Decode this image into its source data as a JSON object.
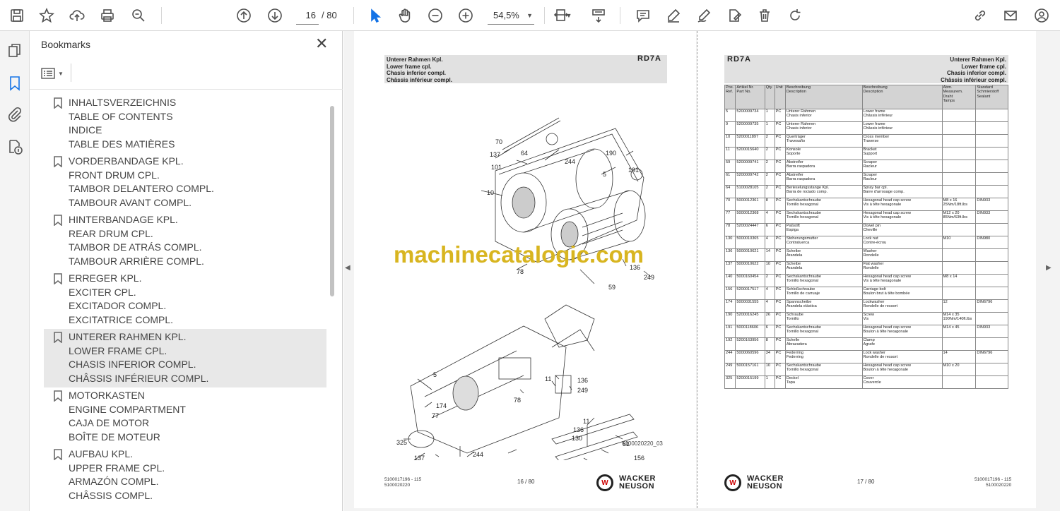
{
  "toolbar": {
    "page_current": "16",
    "page_total": "/ 80",
    "zoom": "54,5%"
  },
  "bookmarks_panel": {
    "title": "Bookmarks",
    "groups": [
      {
        "lines": [
          "INHALTSVERZEICHNIS",
          "TABLE OF CONTENTS",
          "INDICE",
          "TABLE DES MATIÈRES"
        ],
        "selected": false
      },
      {
        "lines": [
          "VORDERBANDAGE KPL.",
          "FRONT DRUM CPL.",
          "TAMBOR DELANTERO COMPL.",
          "TAMBOUR AVANT COMPL."
        ],
        "selected": false
      },
      {
        "lines": [
          "HINTERBANDAGE KPL.",
          "REAR DRUM CPL.",
          "TAMBOR DE ATRÁS COMPL.",
          "TAMBOUR ARRIÈRE COMPL."
        ],
        "selected": false
      },
      {
        "lines": [
          "ERREGER KPL.",
          "EXCITER CPL.",
          "EXCITADOR COMPL.",
          "EXCITATRICE COMPL."
        ],
        "selected": false
      },
      {
        "lines": [
          "UNTERER RAHMEN KPL.",
          "LOWER FRAME CPL.",
          "CHASIS INFERIOR COMPL.",
          "CHÂSSIS INFÉRIEUR COMPL."
        ],
        "selected": true
      },
      {
        "lines": [
          "MOTORKASTEN",
          "ENGINE COMPARTMENT",
          "CAJA DE MOTOR",
          "BOÎTE DE MOTEUR"
        ],
        "selected": false
      },
      {
        "lines": [
          "AUFBAU KPL.",
          "UPPER FRAME CPL.",
          "ARMAZÓN COMPL.",
          "CHÂSSIS COMPL."
        ],
        "selected": false
      }
    ]
  },
  "page_left": {
    "header_lines": [
      "Unterer Rahmen Kpl.",
      "Lower frame cpl.",
      "Chasis inferior compl.",
      "Châssis inférieur compl."
    ],
    "model": "RD7A",
    "watermark": "machinecatalogic.com",
    "drawing_id": "5100020220_03",
    "callouts": [
      "70",
      "137",
      "64",
      "101",
      "244",
      "190",
      "5",
      "191",
      "10",
      "78",
      "136",
      "249",
      "59",
      "5",
      "174",
      "77",
      "325",
      "140",
      "137",
      "191",
      "244",
      "244",
      "190",
      "11",
      "249",
      "136",
      "78",
      "136",
      "130",
      "11",
      "61",
      "156",
      "136",
      "130"
    ],
    "footer_doc": [
      "5100017196 - 115",
      "5100020220"
    ],
    "footer_page": "16 / 80",
    "brand_top": "WACKER",
    "brand_bottom": "NEUSON"
  },
  "page_right": {
    "model": "RD7A",
    "header_lines": [
      "Unterer Rahmen Kpl.",
      "Lower frame cpl.",
      "Chasis inferior compl.",
      "Châssis inférieur compl."
    ],
    "columns": [
      "Pos.\nRef.",
      "Artikel Nr.\nPart No.",
      "Qty.",
      "Unit",
      "Beschreibung\nDescription",
      "Beschreibung\nDescription",
      "Abm.\nMeasurem.\nDraht\nTamps",
      "Standard\nSchmierstoff\nSealant"
    ],
    "rows": [
      [
        "5",
        "5200009734",
        "1",
        "PC",
        "Unterer Rahmen\nChasis inferior",
        "Lower frame\nChâssis inférieur",
        "",
        ""
      ],
      [
        "9",
        "5200009735",
        "1",
        "PC",
        "Unterer Rahmen\nChasis inferior",
        "Lower frame\nChâssis inférieur",
        "",
        ""
      ],
      [
        "10",
        "5200011897",
        "2",
        "PC",
        "Querträger\nTravesaño",
        "Cross member\nTraverse",
        "",
        ""
      ],
      [
        "11",
        "5200015640",
        "2",
        "PC",
        "Konsole\nSoporte",
        "Bracket\nSupport",
        "",
        ""
      ],
      [
        "59",
        "5200009741",
        "2",
        "PC",
        "Abstreifer\nBarra raspadora",
        "Scraper\nRacleur",
        "",
        ""
      ],
      [
        "61",
        "5200009742",
        "2",
        "PC",
        "Abstreifer\nBarra raspadora",
        "Scraper\nRacleur",
        "",
        ""
      ],
      [
        "64",
        "5100028105",
        "2",
        "PC",
        "Berieselungsstange Kpl.\nBarra de rociado comp.",
        "Spray bar cpl.\nBarre d'arrosage comp.",
        "",
        ""
      ],
      [
        "70",
        "5000012361",
        "8",
        "PC",
        "Sechskantschraube\nTornillo hexagonal",
        "Hexagonal head cap screw\nVis à tête hexagonale",
        "M8 x 16\n25Nm/18ft.lbs",
        "DIN933"
      ],
      [
        "77",
        "5000012368",
        "4",
        "PC",
        "Sechskantschraube\nTornillo hexagonal",
        "Hexagonal head cap screw\nVis à tête hexagonale",
        "M12 x 20\n85Nm/63ft.lbs",
        "DIN933"
      ],
      [
        "78",
        "5200024447",
        "6",
        "PC",
        "Paßstift\nEspiga",
        "Dowel pin\nCheville",
        "",
        ""
      ],
      [
        "130",
        "5000010365",
        "4",
        "PC",
        "Stoherungsmutter\nContratuerca",
        "Lock nut\nContre-écrou",
        "M10",
        "DIN980"
      ],
      [
        "136",
        "5000010621",
        "14",
        "PC",
        "Scheibe\nArandela",
        "Washer\nRondelle",
        "",
        ""
      ],
      [
        "137",
        "5000010622",
        "10",
        "PC",
        "Scheibe\nArandela",
        "Flat washer\nRondelle",
        "",
        ""
      ],
      [
        "140",
        "5000160454",
        "2",
        "PC",
        "Sechskantschraube\nTornillo hexagonal",
        "Hexagonal head cap screw\nVis à tête hexagonale",
        "M8 x 14",
        ""
      ],
      [
        "156",
        "5200017517",
        "4",
        "PC",
        "Schloßschraube\nTornillo de carruaje",
        "Carriage bolt\nBoulon brut à tête bombée",
        "",
        ""
      ],
      [
        "174",
        "5000031555",
        "4",
        "PC",
        "Spannscheibe\nArandela elástica",
        "Lockwasher\nRondelle de ressort",
        "12",
        "DIN6796"
      ],
      [
        "190",
        "5200016245",
        "26",
        "PC",
        "Schraube\nTornillo",
        "Screw\nVis",
        "M14 x 35\n190Nm/140ft.lbs",
        ""
      ],
      [
        "191",
        "5000118606",
        "6",
        "PC",
        "Sechskantschraube\nTornillo hexagonal",
        "Hexagonal head cap screw\nBoulon à tête hexagonale",
        "M14 x 45",
        "DIN933"
      ],
      [
        "192",
        "5200163956",
        "8",
        "PC",
        "Schelle\nAbrazadera",
        "Clamp\nAgrafe",
        "",
        ""
      ],
      [
        "244",
        "5000060596",
        "34",
        "PC",
        "Federring\nFederring",
        "Lock washer\nRondelle de ressort",
        "14",
        "DIN6796"
      ],
      [
        "249",
        "5000157161",
        "10",
        "PC",
        "Sechskantschraube\nTornillo hexagonal",
        "Hexagonal head cap screw\nBoulon à tête hexagonale",
        "M10 x 20",
        ""
      ],
      [
        "325",
        "5200015199",
        "1",
        "PC",
        "Deckel\nTapa",
        "Cover\nCouvercle",
        "",
        ""
      ]
    ],
    "footer_page": "17 / 80",
    "footer_doc": [
      "5100017196 - 115",
      "5100020220"
    ],
    "brand_top": "WACKER",
    "brand_bottom": "NEUSON"
  }
}
